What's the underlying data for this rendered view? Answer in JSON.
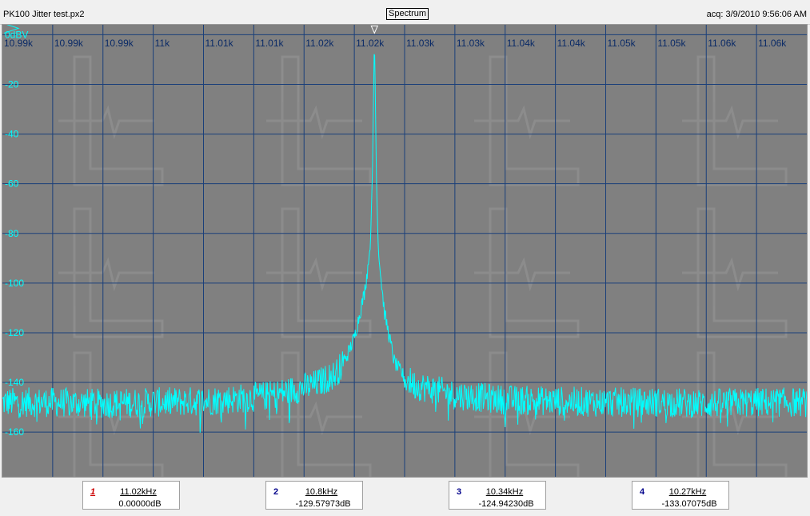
{
  "header": {
    "filename": "PK100 Jitter test.px2",
    "view_label": "Spectrum",
    "acq_label": "acq:",
    "acq_time": "3/9/2010 9:56:06 AM"
  },
  "colors": {
    "plot_bg": "#808080",
    "grid": "#1a3f7a",
    "trace": "#00ffff",
    "x_tick_text": "#0a2a66",
    "y_tick_text": "#00ffff"
  },
  "chart_data": {
    "type": "line",
    "title": "",
    "xlabel": "",
    "ylabel": "",
    "x_tick_labels": [
      "10.99k",
      "10.99k",
      "10.99k",
      "11k",
      "11.01k",
      "11.01k",
      "11.02k",
      "11.02k",
      "11.03k",
      "11.03k",
      "11.04k",
      "11.04k",
      "11.05k",
      "11.05k",
      "11.06k",
      "11.06k"
    ],
    "y_tick_labels": [
      "0dBV",
      "-20",
      "-40",
      "-60",
      "-80",
      "-100",
      "-120",
      "-140",
      "-160"
    ],
    "xlim": [
      10985,
      11065
    ],
    "ylim": [
      -178,
      4
    ],
    "grid": true,
    "series": [
      {
        "x": [
          10985,
          10990,
          10995,
          11000,
          11005,
          11010,
          11012,
          11014,
          11016,
          11018,
          11019,
          11020,
          11020.5,
          11021,
          11021.3,
          11021.6,
          11021.8,
          11022.0,
          11022.2,
          11022.4,
          11022.7,
          11023,
          11023.5,
          11024,
          11025,
          11026,
          11028,
          11030,
          11035,
          11040,
          11045,
          11050,
          11055,
          11060,
          11065
        ],
        "y": [
          -148,
          -148,
          -148.5,
          -148,
          -147.5,
          -146,
          -145,
          -143,
          -141,
          -137,
          -132,
          -122,
          -113,
          -104,
          -95,
          -85,
          -55,
          0,
          -58,
          -88,
          -100,
          -112,
          -122,
          -132,
          -138,
          -141,
          -143,
          -145,
          -147,
          -147.5,
          -148,
          -148,
          -148.5,
          -148,
          -148
        ]
      }
    ],
    "markers": [
      {
        "label": "1",
        "x": 11022.0,
        "y": 0
      }
    ]
  },
  "marker_readouts": [
    {
      "num": "1",
      "freq": "11.02kHz",
      "amp": "0.00000dB",
      "active": true
    },
    {
      "num": "2",
      "freq": "10.8kHz",
      "amp": "-129.57973dB",
      "active": false
    },
    {
      "num": "3",
      "freq": "10.34kHz",
      "amp": "-124.94230dB",
      "active": false
    },
    {
      "num": "4",
      "freq": "10.27kHz",
      "amp": "-133.07075dB",
      "active": false
    }
  ]
}
